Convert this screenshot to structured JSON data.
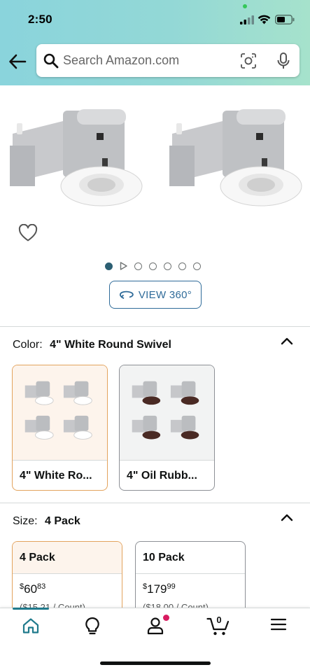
{
  "status_bar": {
    "time": "2:50"
  },
  "search": {
    "placeholder": "Search Amazon.com"
  },
  "carousel": {
    "image_count": 7,
    "active_index": 0,
    "view360_label": "VIEW 360°"
  },
  "color": {
    "label": "Color:",
    "selected": "4\" White Round Swivel",
    "options": [
      {
        "label": "4\" White Ro...",
        "selected": true
      },
      {
        "label": "4\" Oil Rubb...",
        "selected": false
      }
    ]
  },
  "size": {
    "label": "Size:",
    "selected": "4 Pack",
    "options": [
      {
        "name": "4 Pack",
        "price_symbol": "$",
        "price_whole": "60",
        "price_fraction": "83",
        "unit_price": "($15.21 / Count)",
        "selected": true
      },
      {
        "name": "10 Pack",
        "price_symbol": "$",
        "price_whole": "179",
        "price_fraction": "99",
        "unit_price": "($18.00 / Count)",
        "selected": false
      }
    ]
  },
  "bottom_nav": {
    "items": [
      "home-icon",
      "lightbulb-icon",
      "account-icon",
      "cart-icon",
      "menu-icon"
    ],
    "cart_count": "0"
  },
  "colors": {
    "header_gradient_start": "#8ad4dc",
    "header_gradient_end": "#a6e2cc",
    "selected_border": "#e3a35d",
    "selected_fill": "#fdf4ec",
    "link_blue": "#2f6b99",
    "nav_active": "#1f7a8c",
    "badge": "#d81b60"
  }
}
